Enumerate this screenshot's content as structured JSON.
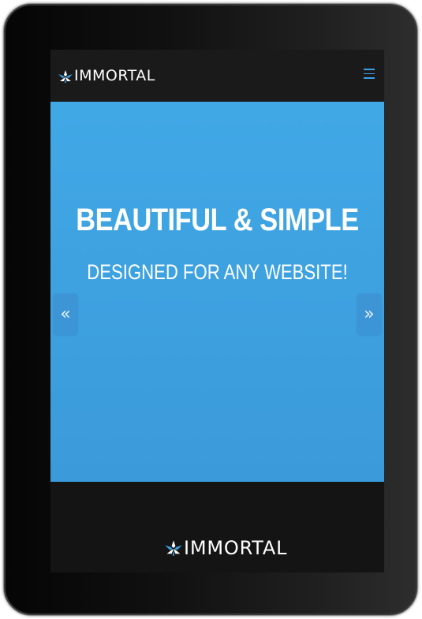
{
  "header": {
    "logo_text": "IMMORTAL",
    "menu_icon": "hamburger-menu-icon",
    "accent_color": "#3aa1e6"
  },
  "hero": {
    "title": "BEAUTIFUL & SIMPLE",
    "subtitle": "DESIGNED FOR ANY WEBSITE!",
    "background_color": "#41a8e6",
    "prev_arrow": "«",
    "next_arrow": "»"
  },
  "footer": {
    "logo_text": "IMMORTAL"
  }
}
